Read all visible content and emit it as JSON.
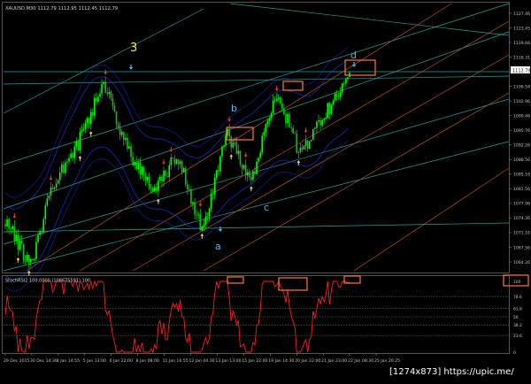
{
  "window": {
    "main_header": "XAUUSD,M30  1112.79 1112.95 1112.45 1112.79",
    "sub_header": "StochRSI2 100.0000 (108675591) 100"
  },
  "colors": {
    "background": "#000000",
    "bull_candle": "#00ff00",
    "bear_candle": "#00cc00",
    "osc_line": "#ff1a1a",
    "axis_text": "#c8c8c8",
    "highlight_box": "#ff7a33",
    "channel_teal": "#2aa198",
    "channel_orange": "#b2552a",
    "band_blue": "#2233ee",
    "arrow_up": "#ff3030",
    "arrow_down": "#f5d28a",
    "arrow_cyan": "#3fb5ff",
    "wave_yellow": "#ffee33",
    "wave_cyan": "#44bbee"
  },
  "chart_data": [
    {
      "type": "candlestick",
      "title": "XAUUSD,M30  1112.79 1112.95 1112.45 1112.79",
      "ylim": [
        1062.0,
        1130.5
      ],
      "y_ticks": [
        "1127.46",
        "1123.45",
        "1119.66",
        "1116.31",
        "1109.36",
        "1106.54",
        "1102.96",
        "1099.46",
        "1095.76",
        "1092.26",
        "1088.56",
        "1085.16",
        "1081.56",
        "1077.96",
        "1074.36",
        "1071.16",
        "1067.56",
        "1064.26"
      ],
      "x_ticks": [
        "29 Dec 2015",
        "30 Dec 14:30",
        "4 Jan 14:55",
        "5 Jan 13:00",
        "6 Jan 22:00",
        "8 Jan 08:00",
        "11 Jan 16:55",
        "12 Jan 04:30",
        "13 Jan 13:00",
        "15 Jan 22:00",
        "19 Jan 14:30",
        "20 Jan 22:00",
        "21 Jan 23:00",
        "22 Jan 08:30",
        "25 Jan 20:25"
      ],
      "current_price": "1112.79",
      "wave_labels": [
        "3",
        "b",
        "a",
        "c",
        "d"
      ],
      "pivots": [
        {
          "x": "29 Dec 2015",
          "price": 1075
        },
        {
          "x": "30 Dec 14:30",
          "price": 1063
        },
        {
          "x": "4 Jan 14:55",
          "price": 1085
        },
        {
          "x": "5 Jan 13:00",
          "price": 1095
        },
        {
          "x": "6 Jan 22:00",
          "price": 1110
        },
        {
          "x": "8 Jan 08:00",
          "price": 1093
        },
        {
          "x": "11 Jan 16:55",
          "price": 1082
        },
        {
          "x": "12 Jan 04:30",
          "price": 1092
        },
        {
          "x": "13 Jan 13:00",
          "price": 1072
        },
        {
          "x": "15 Jan 22:00",
          "price": 1098
        },
        {
          "x": "19 Jan 14:30",
          "price": 1085
        },
        {
          "x": "20 Jan 22:00",
          "price": 1108
        },
        {
          "x": "21 Jan 23:00",
          "price": 1092
        },
        {
          "x": "22 Jan 08:30",
          "price": 1102
        },
        {
          "x": "25 Jan 20:25",
          "price": 1112.8
        }
      ]
    },
    {
      "type": "line",
      "title": "StochRSI2 100.0000 (108675591) 100",
      "ylim": [
        0,
        100
      ],
      "y_ticks": [
        "100",
        "78.6",
        "61.8",
        "50",
        "38.2",
        "23.6",
        "0"
      ],
      "levels": [
        78.6,
        61.8,
        50,
        38.2,
        23.6
      ],
      "last_value": "100"
    }
  ],
  "watermark": "[1274x873] https://upic.me/"
}
